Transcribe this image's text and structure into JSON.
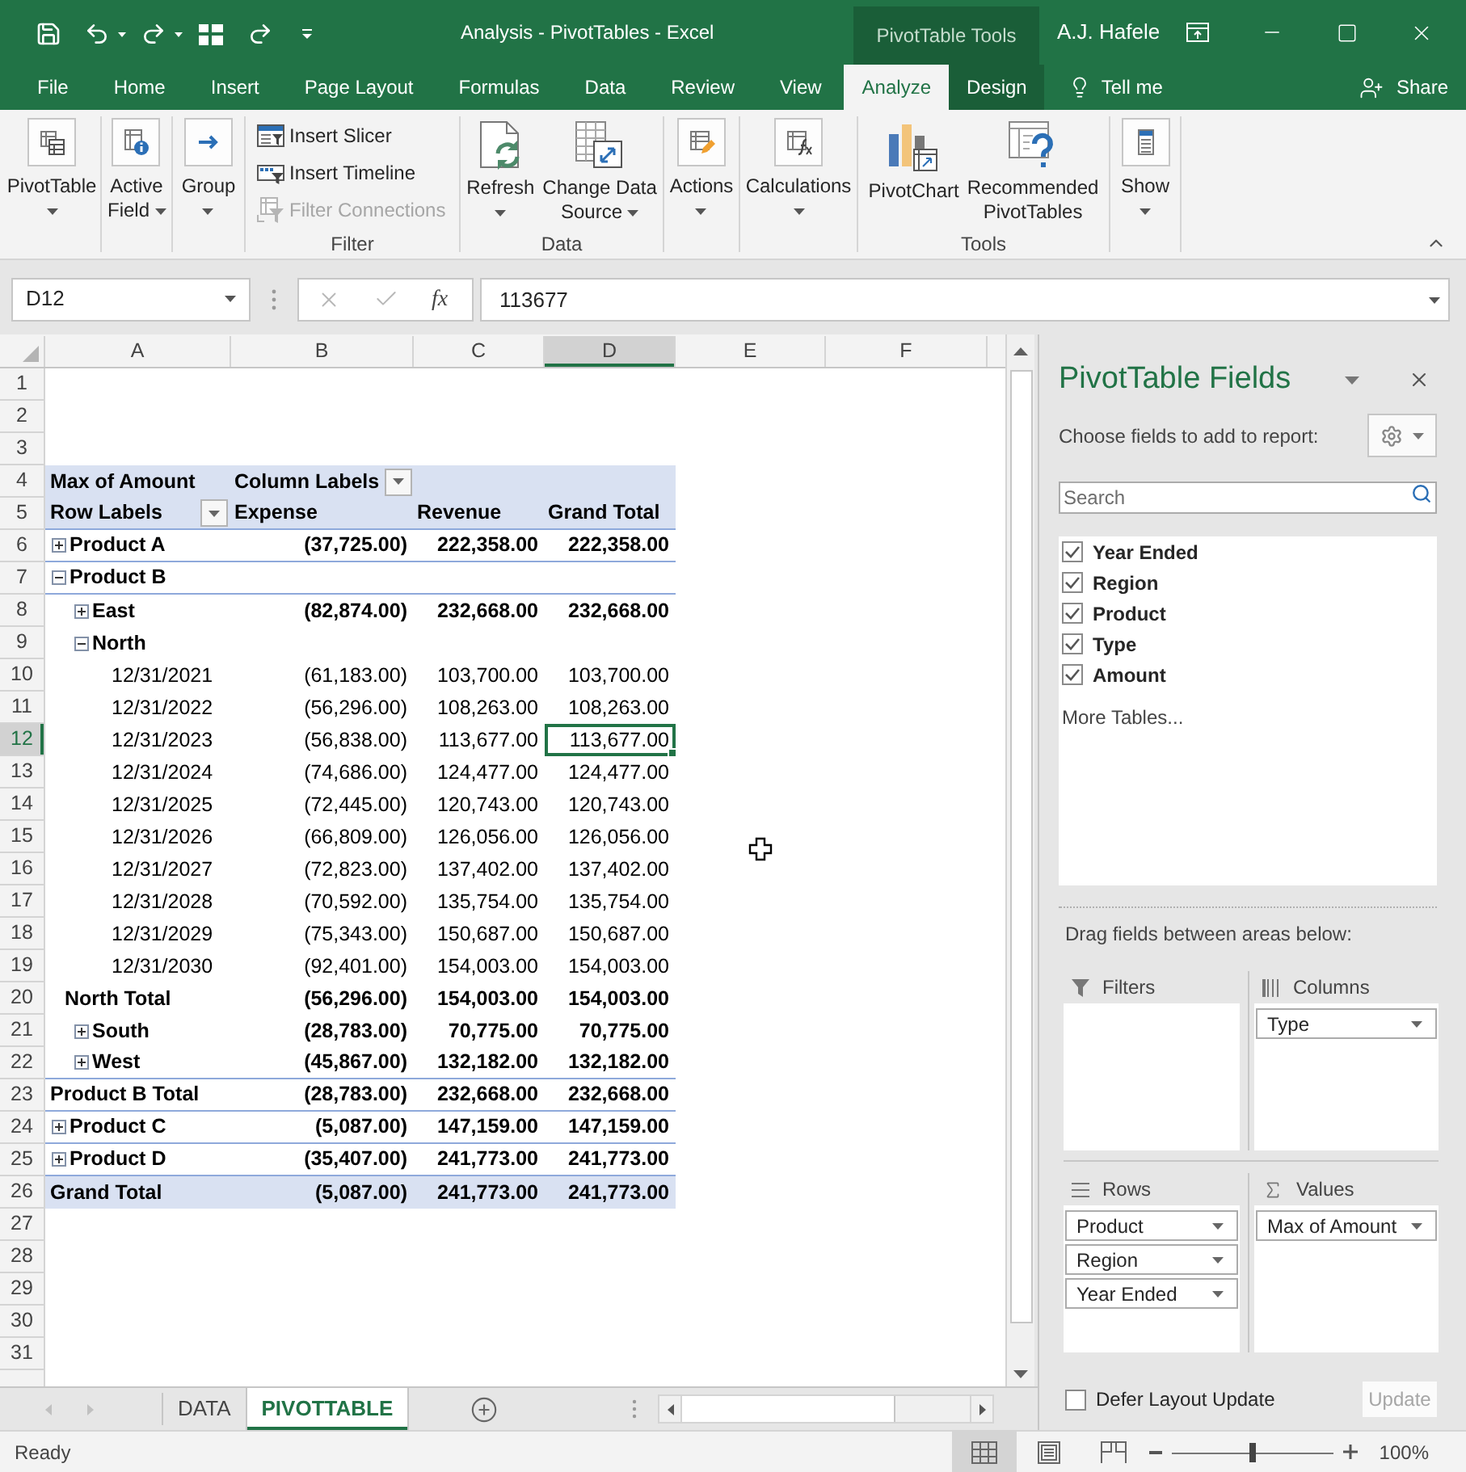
{
  "title_bar": {
    "title": "Analysis - PivotTables - Excel",
    "context_label": "PivotTable Tools",
    "user": "A.J. Hafele"
  },
  "tabs": [
    {
      "label": "File",
      "selected": false,
      "contextual": false
    },
    {
      "label": "Home",
      "selected": false,
      "contextual": false
    },
    {
      "label": "Insert",
      "selected": false,
      "contextual": false
    },
    {
      "label": "Page Layout",
      "selected": false,
      "contextual": false
    },
    {
      "label": "Formulas",
      "selected": false,
      "contextual": false
    },
    {
      "label": "Data",
      "selected": false,
      "contextual": false
    },
    {
      "label": "Review",
      "selected": false,
      "contextual": false
    },
    {
      "label": "View",
      "selected": false,
      "contextual": false
    },
    {
      "label": "Analyze",
      "selected": true,
      "contextual": true
    },
    {
      "label": "Design",
      "selected": false,
      "contextual": true
    }
  ],
  "tell_me": "Tell me",
  "share": "Share",
  "ribbon": {
    "groups": [
      {
        "kind": "collapsed",
        "buttons": [
          {
            "lines": [
              "PivotTable"
            ],
            "dropdown": true
          }
        ]
      },
      {
        "kind": "collapsed",
        "buttons": [
          {
            "lines": [
              "Active",
              "Field"
            ],
            "dropdown": true
          }
        ]
      },
      {
        "kind": "collapsed",
        "buttons": [
          {
            "lines": [
              "Group"
            ],
            "dropdown": true
          }
        ]
      },
      {
        "kind": "small",
        "label": "Filter",
        "buttons": [
          {
            "lines": [
              "Insert Slicer"
            ],
            "disabled": false
          },
          {
            "lines": [
              "Insert Timeline"
            ],
            "disabled": false
          },
          {
            "lines": [
              "Filter Connections"
            ],
            "disabled": true
          }
        ]
      },
      {
        "kind": "large",
        "label": "Data",
        "buttons": [
          {
            "lines": [
              "Refresh"
            ],
            "dropdown": true
          },
          {
            "lines": [
              "Change Data",
              "Source"
            ],
            "dropdown": true
          }
        ]
      },
      {
        "kind": "collapsed",
        "buttons": [
          {
            "lines": [
              "Actions"
            ],
            "dropdown": true
          }
        ]
      },
      {
        "kind": "collapsed",
        "buttons": [
          {
            "lines": [
              "Calculations"
            ],
            "dropdown": true
          }
        ]
      },
      {
        "kind": "large",
        "label": "Tools",
        "buttons": [
          {
            "lines": [
              "PivotChart"
            ],
            "dropdown": false
          },
          {
            "lines": [
              "Recommended",
              "PivotTables"
            ],
            "dropdown": false
          }
        ]
      },
      {
        "kind": "collapsed",
        "buttons": [
          {
            "lines": [
              "Show"
            ],
            "dropdown": true
          }
        ]
      }
    ]
  },
  "formula_bar": {
    "name_box": "D12",
    "function_label": "fx",
    "formula": "113677"
  },
  "sheet": {
    "column_headers": [
      {
        "label": "A",
        "selected": false
      },
      {
        "label": "B",
        "selected": false
      },
      {
        "label": "C",
        "selected": false
      },
      {
        "label": "D",
        "selected": true
      },
      {
        "label": "E",
        "selected": false
      },
      {
        "label": "F",
        "selected": false
      }
    ],
    "row_numbers": [
      {
        "label": "1",
        "selected": false
      },
      {
        "label": "2",
        "selected": false
      },
      {
        "label": "3",
        "selected": false
      },
      {
        "label": "4",
        "selected": false
      },
      {
        "label": "5",
        "selected": false
      },
      {
        "label": "6",
        "selected": false
      },
      {
        "label": "7",
        "selected": false
      },
      {
        "label": "8",
        "selected": false
      },
      {
        "label": "9",
        "selected": false
      },
      {
        "label": "10",
        "selected": false
      },
      {
        "label": "11",
        "selected": false
      },
      {
        "label": "12",
        "selected": true
      },
      {
        "label": "13",
        "selected": false
      },
      {
        "label": "14",
        "selected": false
      },
      {
        "label": "15",
        "selected": false
      },
      {
        "label": "16",
        "selected": false
      },
      {
        "label": "17",
        "selected": false
      },
      {
        "label": "18",
        "selected": false
      },
      {
        "label": "19",
        "selected": false
      },
      {
        "label": "20",
        "selected": false
      },
      {
        "label": "21",
        "selected": false
      },
      {
        "label": "22",
        "selected": false
      },
      {
        "label": "23",
        "selected": false
      },
      {
        "label": "24",
        "selected": false
      },
      {
        "label": "25",
        "selected": false
      },
      {
        "label": "26",
        "selected": false
      },
      {
        "label": "27",
        "selected": false
      },
      {
        "label": "28",
        "selected": false
      },
      {
        "label": "29",
        "selected": false
      },
      {
        "label": "30",
        "selected": false
      },
      {
        "label": "31",
        "selected": false
      }
    ],
    "pivot": {
      "value_field": "Max of Amount",
      "column_labels": "Column Labels",
      "row_labels": "Row Labels",
      "columns": [
        "Expense",
        "Revenue",
        "Grand Total"
      ],
      "items": [
        {
          "label": "Product A",
          "expanded": false,
          "values": [
            "(37,725.00)",
            "222,358.00",
            "222,358.00"
          ]
        },
        {
          "label": "Product B",
          "expanded": true,
          "children": [
            {
              "label": "East",
              "expanded": false,
              "values": [
                "(82,874.00)",
                "232,668.00",
                "232,668.00"
              ]
            },
            {
              "label": "North",
              "expanded": true,
              "children": [
                {
                  "label": "12/31/2021",
                  "values": [
                    "(61,183.00)",
                    "103,700.00",
                    "103,700.00"
                  ]
                },
                {
                  "label": "12/31/2022",
                  "values": [
                    "(56,296.00)",
                    "108,263.00",
                    "108,263.00"
                  ]
                },
                {
                  "label": "12/31/2023",
                  "values": [
                    "(56,838.00)",
                    "113,677.00",
                    "113,677.00"
                  ]
                },
                {
                  "label": "12/31/2024",
                  "values": [
                    "(74,686.00)",
                    "124,477.00",
                    "124,477.00"
                  ]
                },
                {
                  "label": "12/31/2025",
                  "values": [
                    "(72,445.00)",
                    "120,743.00",
                    "120,743.00"
                  ]
                },
                {
                  "label": "12/31/2026",
                  "values": [
                    "(66,809.00)",
                    "126,056.00",
                    "126,056.00"
                  ]
                },
                {
                  "label": "12/31/2027",
                  "values": [
                    "(72,823.00)",
                    "137,402.00",
                    "137,402.00"
                  ]
                },
                {
                  "label": "12/31/2028",
                  "values": [
                    "(70,592.00)",
                    "135,754.00",
                    "135,754.00"
                  ]
                },
                {
                  "label": "12/31/2029",
                  "values": [
                    "(75,343.00)",
                    "150,687.00",
                    "150,687.00"
                  ]
                },
                {
                  "label": "12/31/2030",
                  "values": [
                    "(92,401.00)",
                    "154,003.00",
                    "154,003.00"
                  ]
                }
              ],
              "total": {
                "label": "North Total",
                "values": [
                  "(56,296.00)",
                  "154,003.00",
                  "154,003.00"
                ]
              }
            },
            {
              "label": "South",
              "expanded": false,
              "values": [
                "(28,783.00)",
                "70,775.00",
                "70,775.00"
              ]
            },
            {
              "label": "West",
              "expanded": false,
              "values": [
                "(45,867.00)",
                "132,182.00",
                "132,182.00"
              ]
            }
          ],
          "total": {
            "label": "Product B Total",
            "values": [
              "(28,783.00)",
              "232,668.00",
              "232,668.00"
            ]
          }
        },
        {
          "label": "Product C",
          "expanded": false,
          "values": [
            "(5,087.00)",
            "147,159.00",
            "147,159.00"
          ]
        },
        {
          "label": "Product D",
          "expanded": false,
          "values": [
            "(35,407.00)",
            "241,773.00",
            "241,773.00"
          ]
        }
      ],
      "grand_total": {
        "label": "Grand Total",
        "values": [
          "(5,087.00)",
          "241,773.00",
          "241,773.00"
        ]
      }
    }
  },
  "sheet_tabs": [
    {
      "label": "DATA",
      "selected": false
    },
    {
      "label": "PIVOTTABLE",
      "selected": true
    }
  ],
  "field_list": {
    "title": "PivotTable Fields",
    "instruction": "Choose fields to add to report:",
    "search": {
      "placeholder": "Search"
    },
    "fields": [
      {
        "label": "Year Ended",
        "checked": true
      },
      {
        "label": "Region",
        "checked": true
      },
      {
        "label": "Product",
        "checked": true
      },
      {
        "label": "Type",
        "checked": true
      },
      {
        "label": "Amount",
        "checked": true
      }
    ],
    "more_tables": "More Tables...",
    "areas_hint": "Drag fields between areas below:",
    "areas": [
      {
        "kind": "filters",
        "label": "Filters"
      },
      {
        "kind": "columns",
        "label": "Columns",
        "fields": [
          "Type"
        ]
      },
      {
        "kind": "rows",
        "label": "Rows",
        "fields": [
          "Product",
          "Region",
          "Year Ended"
        ]
      },
      {
        "kind": "values",
        "label": "Values",
        "fields": [
          "Max of Amount"
        ]
      }
    ],
    "defer_update": {
      "label": "Defer Layout Update",
      "checked": false
    },
    "update_button": {
      "label": "Update",
      "disabled": true
    }
  },
  "status_bar": {
    "text": "Ready",
    "views": [
      {
        "selected": true
      },
      {
        "selected": false
      },
      {
        "selected": false
      }
    ],
    "zoom_slider": {
      "level": 0.5
    },
    "zoom": "100%"
  }
}
